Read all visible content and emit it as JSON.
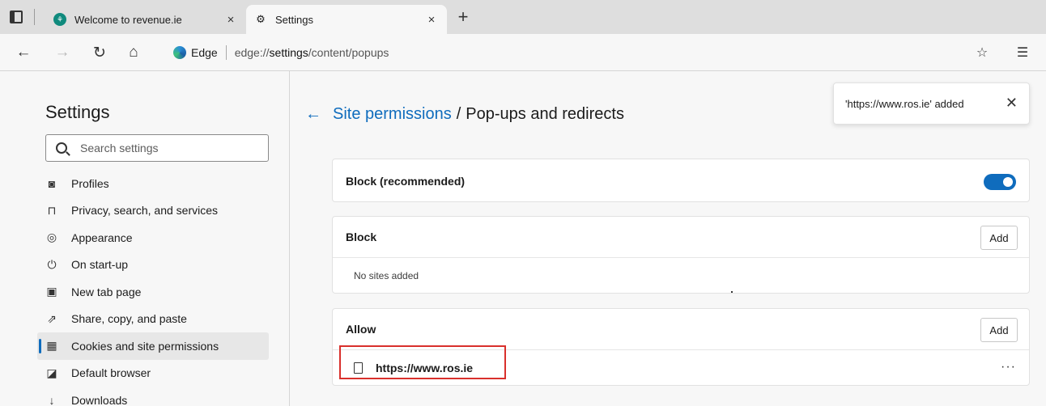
{
  "tabs": [
    {
      "title": "Welcome to revenue.ie",
      "close": "×",
      "favicon": "revenue-favicon"
    },
    {
      "title": "Settings",
      "close": "×",
      "favicon": "gear-icon",
      "active": true
    }
  ],
  "new_tab": "+",
  "toolbar": {
    "site_name": "Edge",
    "url_prefix": "edge://",
    "url_host": "settings",
    "url_path": "/content/popups"
  },
  "sidebar": {
    "title": "Settings",
    "search_placeholder": "Search settings",
    "items": [
      {
        "label": "Profiles",
        "icon": "profile-icon"
      },
      {
        "label": "Privacy, search, and services",
        "icon": "lock-icon"
      },
      {
        "label": "Appearance",
        "icon": "palette-icon"
      },
      {
        "label": "On start-up",
        "icon": "power-icon"
      },
      {
        "label": "New tab page",
        "icon": "new-tab-page-icon"
      },
      {
        "label": "Share, copy, and paste",
        "icon": "share-icon"
      },
      {
        "label": "Cookies and site permissions",
        "icon": "cookies-icon",
        "active": true
      },
      {
        "label": "Default browser",
        "icon": "default-browser-icon"
      },
      {
        "label": "Downloads",
        "icon": "download-icon"
      }
    ]
  },
  "breadcrumb": {
    "parent": "Site permissions",
    "separator": "/",
    "current": "Pop-ups and redirects"
  },
  "toast": {
    "message": "'https://www.ros.ie' added"
  },
  "block_recommended": {
    "label": "Block (recommended)",
    "enabled": true
  },
  "block": {
    "label": "Block",
    "add_label": "Add",
    "empty_text": "No sites added"
  },
  "allow": {
    "label": "Allow",
    "add_label": "Add",
    "sites": [
      {
        "url": "https://www.ros.ie",
        "more": "···"
      }
    ]
  },
  "colors": {
    "accent": "#0f6cbd",
    "highlight": "#d9302c"
  }
}
